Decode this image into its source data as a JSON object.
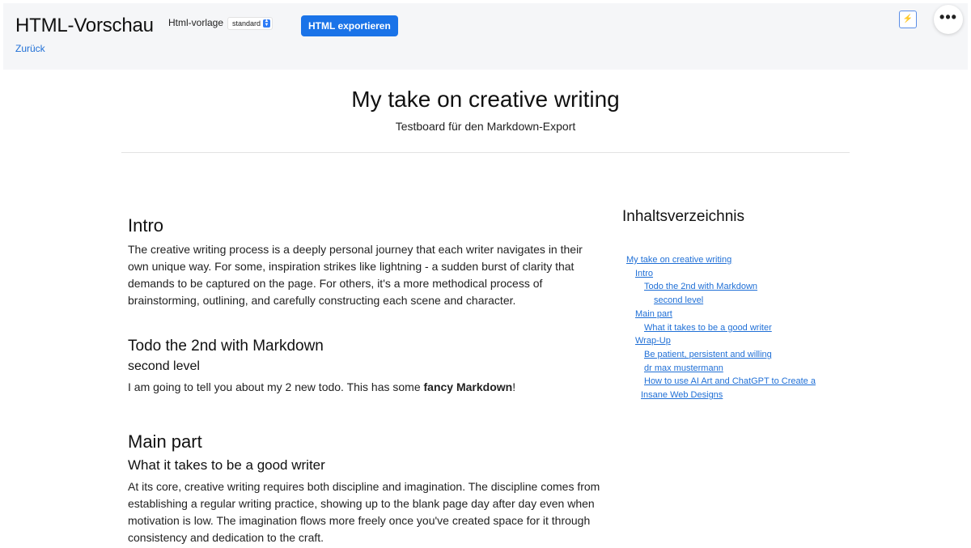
{
  "header": {
    "app_title": "HTML-Vorschau",
    "back_label": "Zurück",
    "template_label": "Html-vorlage",
    "template_value": "standard",
    "export_label": "HTML exportieren",
    "bolt_icon": "⚡",
    "more_icon": "•••"
  },
  "document": {
    "title": "My take on creative writing",
    "subtitle": "Testboard für den Markdown-Export",
    "sections": {
      "intro_heading": "Intro",
      "intro_text": "The creative writing process is a deeply personal journey that each writer navigates in their own unique way. For some, inspiration strikes like lightning - a sudden burst of clarity that demands to be captured on the page. For others, it's a more methodical process of brainstorming, outlining, and carefully constructing each scene and character.",
      "todo_heading": "Todo the 2nd with Markdown",
      "second_level_heading": "second level",
      "todo_text_before": "I am going to tell you about my 2 new todo. This has some ",
      "todo_text_bold": "fancy Markdown",
      "todo_text_after": "!",
      "main_heading": "Main part",
      "main_sub_heading": "What it takes to be a good writer",
      "main_text": "At its core, creative writing requires both discipline and imagination. The discipline comes from establishing a regular writing practice, showing up to the blank page day after day even when motivation is low. The imagination flows more freely once you've created space for it through consistency and dedication to the craft."
    }
  },
  "toc": {
    "title": "Inhaltsverzeichnis",
    "items": [
      "My take on creative writing",
      "Intro",
      "Todo the 2nd with Markdown",
      "second level",
      "Main part",
      "What it takes to be a good writer",
      "Wrap-Up",
      "Be patient, persistent and willing",
      "dr max mustermann",
      "How to use AI Art and ChatGPT to Create a",
      "Insane Web Designs"
    ]
  }
}
